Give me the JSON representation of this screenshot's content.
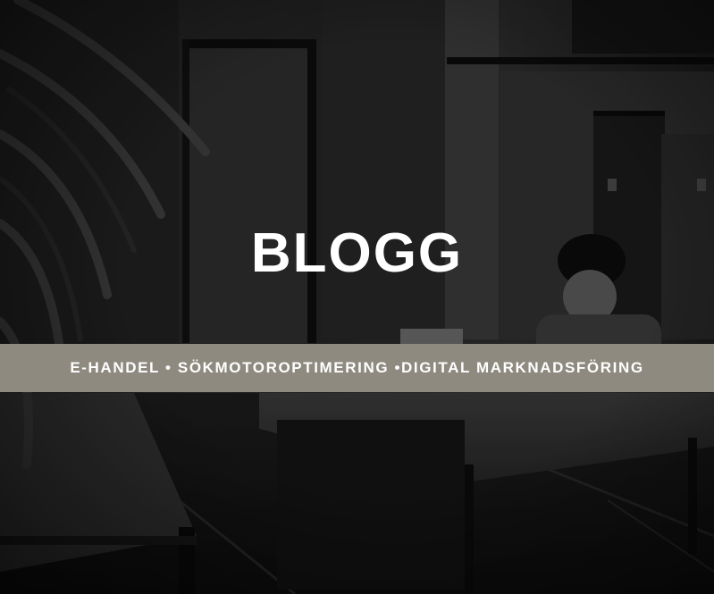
{
  "hero": {
    "title": "BLOGG",
    "subtitle": "E-HANDEL • SÖKMOTOROPTIMERING •DIGITAL MARKNADSFÖRING"
  },
  "colors": {
    "band_background": "#8e8a7f",
    "text": "#ffffff",
    "photo_tone": "#1a1a1a"
  }
}
